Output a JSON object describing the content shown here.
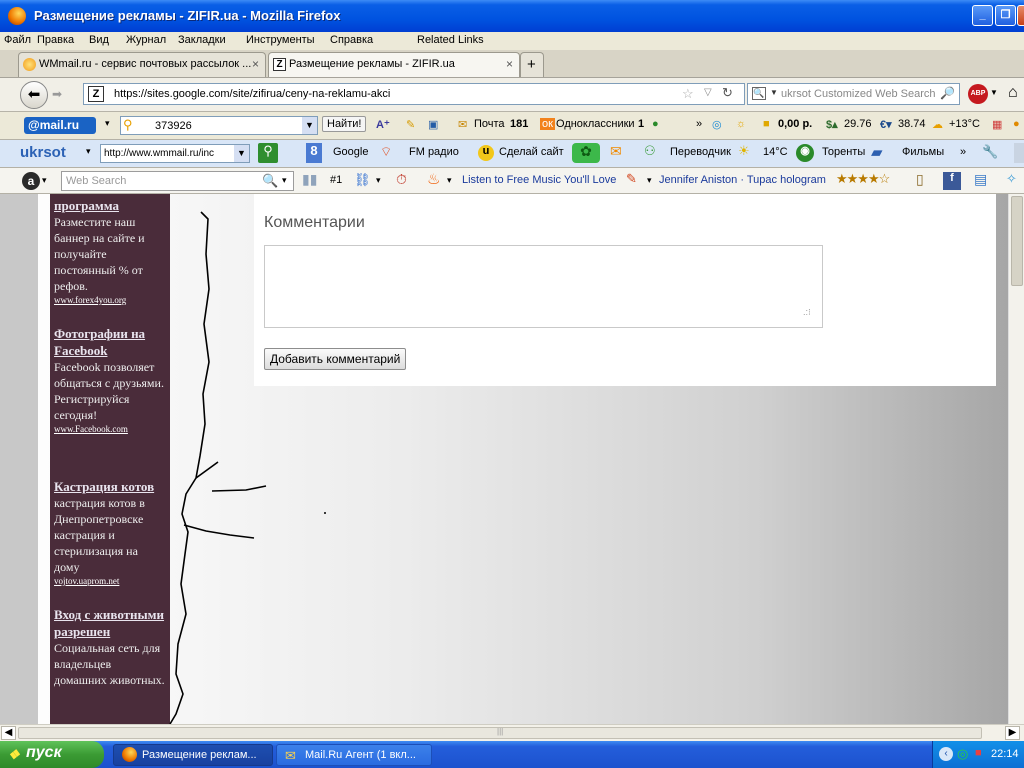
{
  "window": {
    "title": "Размещение рекламы - ZIFIR.ua - Mozilla Firefox"
  },
  "menu": [
    "Файл",
    "Правка",
    "Вид",
    "Журнал",
    "Закладки",
    "Инструменты",
    "Справка",
    "Related Links"
  ],
  "tabs": [
    {
      "label": "WMmail.ru - сервис почтовых рассылок ..."
    },
    {
      "label": "Размещение рекламы - ZIFIR.ua"
    }
  ],
  "nav": {
    "url": "https://sites.google.com/site/zifirua/ceny-na-reklamu-akci",
    "search_placeholder": "ukrsot Customized Web Search"
  },
  "mailru_bar": {
    "logo": "@mail.ru",
    "search_value": "373926",
    "find_label": "Найти!",
    "mail_label": "Почта",
    "mail_count": "181",
    "ok_label": "Одноклассники",
    "ok_count": "1",
    "money": "0,00 р.",
    "usd": "29.76",
    "eur": "38.74",
    "temp": "+13°C"
  },
  "ukrsot_bar": {
    "logo": "ukrsot",
    "url_value": "http://www.wmmail.ru/inc",
    "google": "Google",
    "fm": "FM радио",
    "make_site": "Сделай сайт",
    "translator": "Переводчик",
    "temp": "14°C",
    "torrents": "Торенты",
    "films": "Фильмы"
  },
  "ask_bar": {
    "search_placeholder": "Web Search",
    "rank": "#1",
    "music": "Listen to Free Music You'll Love",
    "news": "Jennifer Aniston · Tupac hologram"
  },
  "sidebar_ads": [
    {
      "title": "программа",
      "desc": "Разместите наш баннер на сайте и получайте постоянный % от рефов.",
      "url": "www.forex4you.org"
    },
    {
      "title": "Фотографии на Facebook",
      "desc": "Facebook позволяет общаться с друзьями. Регистрируйся сегодня!",
      "url": "www.Facebook.com"
    },
    {
      "title": "Кастрация котов",
      "desc": "кастрация котов в Днепропетровске кастрация и стерилизация на дому",
      "url": "vojtov.uaprom.net"
    },
    {
      "title": "Вход с животными разрешен",
      "desc": "Социальная сеть для владельцев домашних животных.",
      "url": ""
    }
  ],
  "comments": {
    "heading": "Комментарии",
    "textarea_value": "",
    "button_label": "Добавить комментарий"
  },
  "taskbar": {
    "start_label": "пуск",
    "tasks": [
      "Размещение реклам...",
      "Mail.Ru Агент (1 вкл..."
    ],
    "clock": "22:14"
  }
}
